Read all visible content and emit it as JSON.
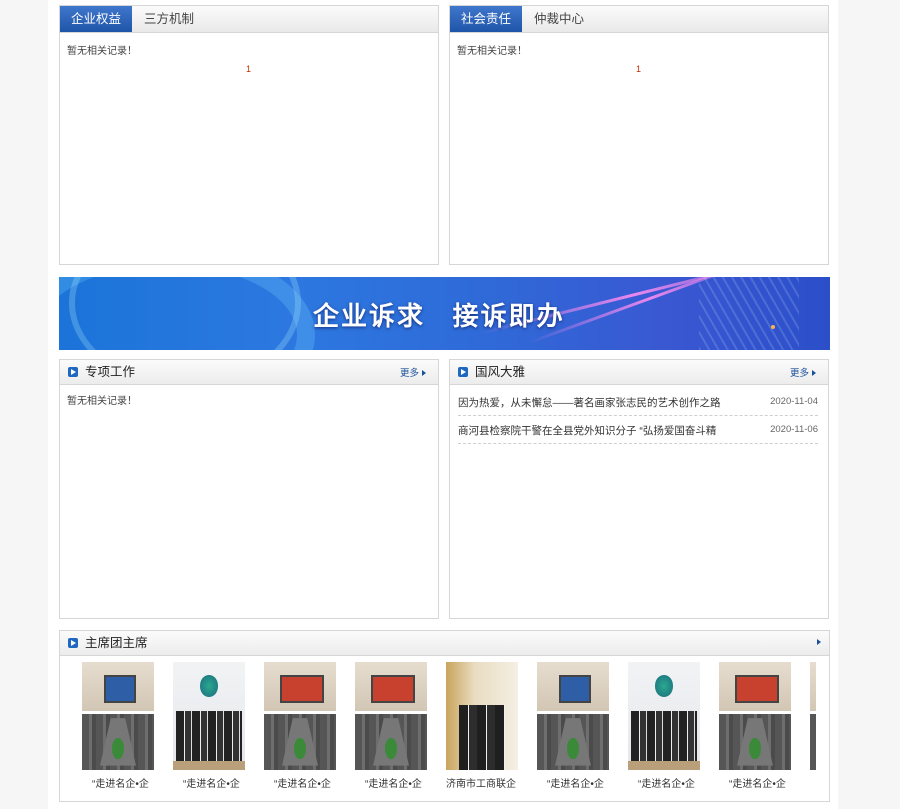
{
  "top_left": {
    "tabs": [
      {
        "label": "企业权益"
      },
      {
        "label": "三方机制"
      }
    ],
    "empty_text": "暂无相关记录！",
    "page_num": "1"
  },
  "top_right": {
    "tabs": [
      {
        "label": "社会责任"
      },
      {
        "label": "仲裁中心"
      }
    ],
    "empty_text": "暂无相关记录！",
    "page_num": "1"
  },
  "banner": {
    "text": "企业诉求   接诉即办"
  },
  "special": {
    "title": "专项工作",
    "more": "更多",
    "empty_text": "暂无相关记录！"
  },
  "guofeng": {
    "title": "国风大雅",
    "more": "更多",
    "items": [
      {
        "title": "因为热爱，从未懈怠——著名画家张志民的艺术创作之路",
        "date": "2020-11-04"
      },
      {
        "title": "商河县检察院干警在全县党外知识分子 “弘扬爱国奋斗精",
        "date": "2020-11-06"
      }
    ]
  },
  "presidium": {
    "title": "主席团主席",
    "items": [
      {
        "caption": "“走进名企•企",
        "kind": "room"
      },
      {
        "caption": "“走进名企•企",
        "kind": "group"
      },
      {
        "caption": "“走进名企•企",
        "kind": "room-red"
      },
      {
        "caption": "“走进名企•企",
        "kind": "room-red"
      },
      {
        "caption": "济南市工商联企",
        "kind": "official"
      },
      {
        "caption": "“走进名企•企",
        "kind": "room"
      },
      {
        "caption": "“走进名企•企",
        "kind": "group"
      },
      {
        "caption": "“走进名企•企",
        "kind": "room-red"
      },
      {
        "caption": "“",
        "kind": "room"
      }
    ]
  }
}
